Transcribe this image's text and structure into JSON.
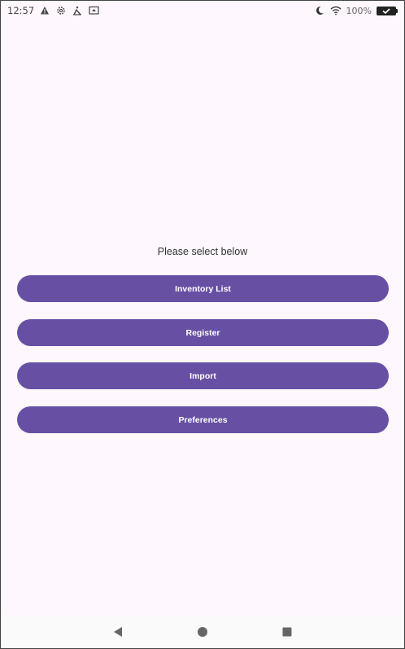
{
  "status_bar": {
    "time": "12:57",
    "battery_percent": "100%",
    "left_icons": [
      "warning-icon",
      "settings-gear-icon",
      "accessibility-icon",
      "cast-icon"
    ],
    "right_icons": [
      "do-not-disturb-moon-icon",
      "wifi-icon",
      "battery-charging-icon"
    ]
  },
  "main": {
    "prompt": "Please select below",
    "buttons": [
      {
        "label": "Inventory List"
      },
      {
        "label": "Register"
      },
      {
        "label": "Import"
      },
      {
        "label": "Preferences"
      }
    ]
  },
  "nav_bar": {
    "icons": [
      "back-icon",
      "home-icon",
      "recents-icon"
    ]
  },
  "colors": {
    "background": "#fef7fd",
    "primary": "#6750a4",
    "on_primary": "#ffffff"
  }
}
